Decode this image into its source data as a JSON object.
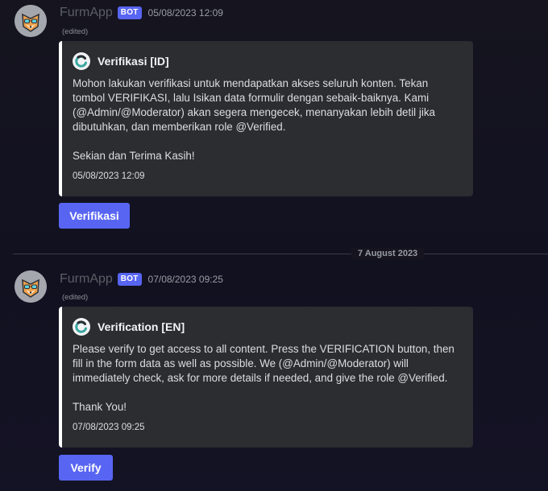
{
  "messages": [
    {
      "username": "FurmApp",
      "bot_tag": "BOT",
      "timestamp": "05/08/2023 12:09",
      "edited": "(edited)",
      "avatar_icon": "fox-mascot-icon",
      "embed": {
        "author_icon": "refresh-circle-icon",
        "author": "Verifikasi [ID]",
        "paragraphs": [
          "Mohon lakukan verifikasi untuk mendapatkan akses seluruh konten. Tekan tombol VERIFIKASI, lalu Isikan data formulir dengan sebaik-baiknya. Kami (@Admin/@Moderator) akan segera mengecek, menanyakan lebih detil jika dibutuhkan, dan memberikan role @Verified.",
          "Sekian dan Terima Kasih!"
        ],
        "footer": "05/08/2023 12:09",
        "accent_color": "#ffffff"
      },
      "button_label": "Verifikasi"
    },
    {
      "username": "FurmApp",
      "bot_tag": "BOT",
      "timestamp": "07/08/2023 09:25",
      "edited": "(edited)",
      "avatar_icon": "fox-mascot-icon",
      "embed": {
        "author_icon": "refresh-circle-icon",
        "author": "Verification [EN]",
        "paragraphs": [
          "Please verify to get access to all content. Press the VERIFICATION button, then fill in the form data as well as possible. We (@Admin/@Moderator) will immediately check, ask for more details if needed, and give the role @Verified.",
          "Thank You!"
        ],
        "footer": "07/08/2023 09:25",
        "accent_color": "#ffffff"
      },
      "button_label": "Verify"
    }
  ],
  "date_divider": "7 August 2023",
  "colors": {
    "background": "#15141f",
    "embed_background": "#2b2d31",
    "button": "#5865f2",
    "bot_tag": "#5865f2"
  }
}
